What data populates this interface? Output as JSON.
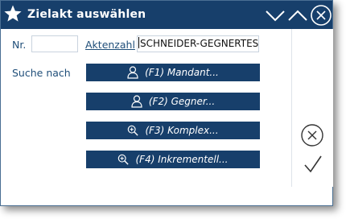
{
  "window": {
    "title": "Zielakt auswählen",
    "icons": [
      "star-icon",
      "chevron-down-icon",
      "chevron-up-icon",
      "close-circle-icon"
    ]
  },
  "form": {
    "nr_label": "Nr.",
    "nr_value": "",
    "aktenzahl_label": "Aktenzahl",
    "aktenzahl_value": "SCHNEIDER-GEGNERTEST",
    "suche_label": "Suche nach"
  },
  "buttons": [
    {
      "label": "(F1) Mandant...",
      "icon": "person-icon"
    },
    {
      "label": "(F2) Gegner...",
      "icon": "person-icon"
    },
    {
      "label": "(F3) Komplex...",
      "icon": "zoom-in-icon"
    },
    {
      "label": "(F4) Inkrementell...",
      "icon": "zoom-in-icon"
    }
  ],
  "side": {
    "cancel_icon": "cancel-circle-icon",
    "ok_icon": "checkmark-icon"
  },
  "colors": {
    "accent": "#173f6b",
    "label": "#1f4e79"
  }
}
